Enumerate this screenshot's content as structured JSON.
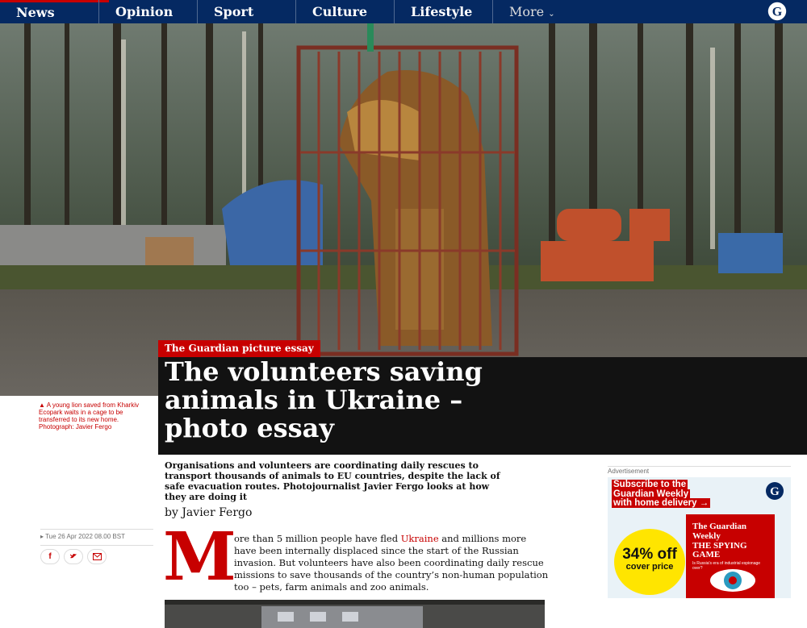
{
  "nav": {
    "items": [
      {
        "label": "News"
      },
      {
        "label": "Opinion"
      },
      {
        "label": "Sport"
      },
      {
        "label": "Culture"
      },
      {
        "label": "Lifestyle"
      }
    ],
    "more_label": "More",
    "logo_letter": "G"
  },
  "hero": {
    "caption": "A young lion saved from Kharkiv Ecopark waits in a cage to be transferred to its new home. Photograph: Javier Fergo"
  },
  "article": {
    "kicker": "The Guardian picture essay",
    "headline": "The volunteers saving animals in Ukraine – photo essay",
    "standfirst": "Organisations and volunteers are coordinating daily rescues to transport thousands of animals to EU countries, despite the lack of safe evacuation routes. Photojournalist Javier Fergo looks at how they are doing it",
    "byline": "by Javier Fergo",
    "date": "Tue 26 Apr 2022 08.00 BST",
    "share": {
      "facebook": "f",
      "twitter": "t",
      "email": "@"
    },
    "dropcap": "M",
    "body_line1_pre": "ore than 5 million people have fled ",
    "body_link": "Ukraine",
    "body_line1_post": " and millions more",
    "body_rest": "have been internally displaced since the start of the Russian invasion. But volunteers have also been coordinating daily rescue missions to save thousands of the country’s non-human population too – pets, farm animals and zoo animals."
  },
  "ad": {
    "label": "Advertisement",
    "headline_lines": [
      "Subscribe to the",
      "Guardian Weekly",
      "with home delivery →"
    ],
    "discount": "34% off",
    "discount_sub": "cover price",
    "magazine_title": "The Guardian Weekly",
    "magazine_cover": "THE SPYING GAME",
    "magazine_sub": "Is Russia's era of industrial espionage over?",
    "logo_letter": "G"
  },
  "colors": {
    "nav_bg": "#052962",
    "accent": "#c70000",
    "headline_bg": "#121212"
  }
}
